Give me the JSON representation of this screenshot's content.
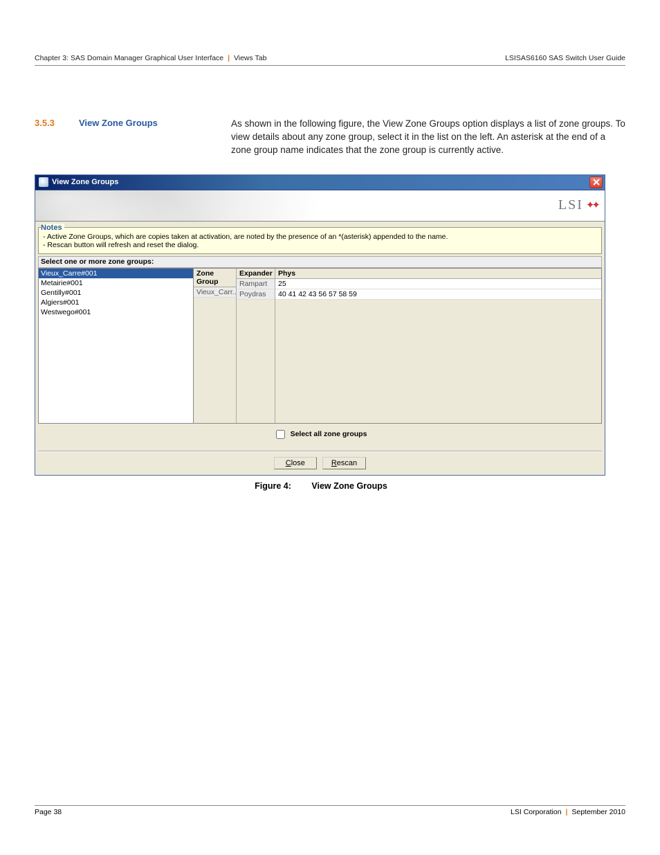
{
  "header": {
    "chapter_breadcrumb": "Chapter 3: SAS Domain Manager Graphical User Interface",
    "breadcrumb_tail": "Views Tab",
    "doc_title": "LSISAS6160 SAS Switch User Guide"
  },
  "section": {
    "number": "3.5.3",
    "title": "View Zone Groups",
    "body": "As shown in the following figure, the View Zone Groups option displays a list of zone groups. To view details about any zone group, select it in the list on the left. An asterisk at the end of a zone group name indicates that the zone group is currently active."
  },
  "dialog": {
    "title": "View Zone Groups",
    "logo_text": "LSI",
    "notes": {
      "heading": "Notes",
      "line1": "- Active Zone Groups, which are copies taken at activation, are noted by the presence of an *(asterisk) appended to the name.",
      "line2": "- Rescan button will refresh and reset the dialog."
    },
    "select_header": "Select one or more zone groups:",
    "zone_list": [
      "Vieux_Carre#001",
      "Metairie#001",
      "Gentilly#001",
      "Algiers#001",
      "Westwego#001"
    ],
    "grid": {
      "headers": {
        "c1": "Zone Group",
        "c2": "Expander",
        "c3": "Phys"
      },
      "rows": [
        {
          "c1": "Vieux_Carr...",
          "c2": "Rampart",
          "c3": "25"
        },
        {
          "c1": "",
          "c2": "Poydras",
          "c3": "40 41 42 43 56 57 58 59"
        }
      ]
    },
    "select_all_label": "Select all zone groups",
    "buttons": {
      "close": "Close",
      "rescan": "Rescan"
    }
  },
  "figure": {
    "label": "Figure 4:",
    "title": "View Zone Groups"
  },
  "footer": {
    "page": "Page 38",
    "corp": "LSI Corporation",
    "date": "September 2010"
  }
}
